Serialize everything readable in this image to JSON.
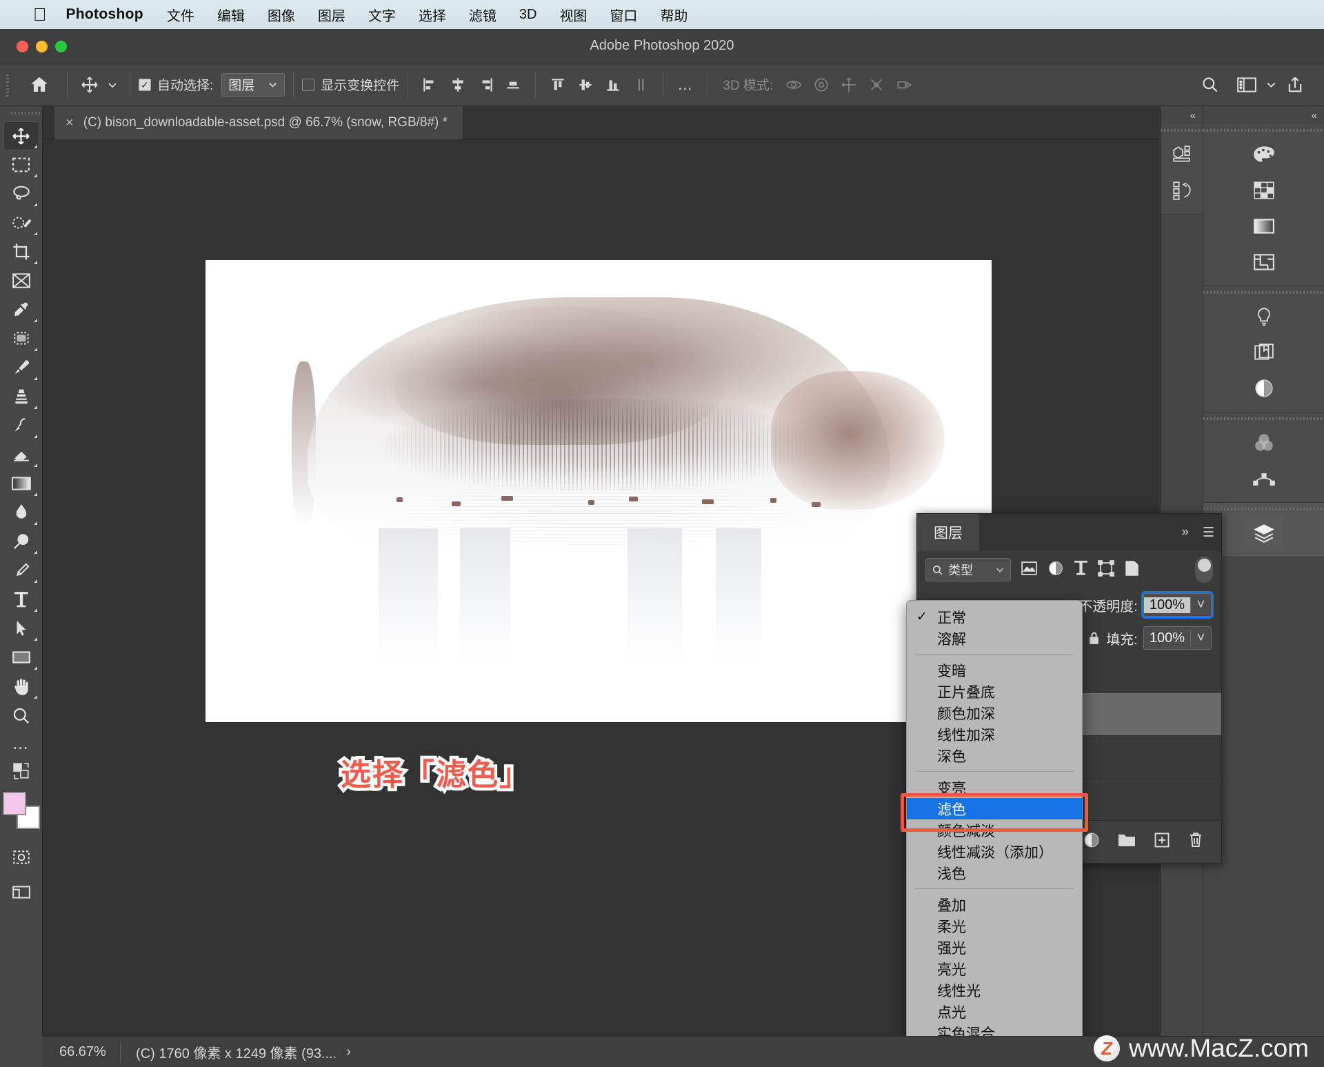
{
  "macmenu": {
    "apple_icon": "apple-logo-icon",
    "app_name": "Photoshop",
    "items": [
      "文件",
      "编辑",
      "图像",
      "图层",
      "文字",
      "选择",
      "滤镜",
      "3D",
      "视图",
      "窗口",
      "帮助"
    ]
  },
  "window": {
    "title": "Adobe Photoshop 2020"
  },
  "options_bar": {
    "home_icon": "home-icon",
    "move_tool_icon": "move-tool-icon",
    "auto_select_label": "自动选择:",
    "auto_select_checked": true,
    "auto_select_value": "图层",
    "show_transform_label": "显示变换控件",
    "show_transform_checked": false,
    "align_icons": [
      "align-left-icon",
      "align-center-horizontal-icon",
      "align-right-icon",
      "align-bottom-icon",
      "align-top-icon",
      "distribute-vertical-icon",
      "align-middle-icon",
      "distribute-horizontal-icon"
    ],
    "more_icon": "more-options-icon",
    "mode_3d_label": "3D 模式:",
    "mode_3d_icons": [
      "orbit-3d-icon",
      "roll-3d-icon",
      "pan-3d-icon",
      "slide-3d-icon",
      "scale-3d-icon"
    ],
    "search_icon": "search-icon",
    "workspace_icon": "workspace-layout-icon",
    "workspace_chevron": "chevron-down-icon",
    "share_icon": "share-upload-icon"
  },
  "toolbar": {
    "tools": [
      {
        "name": "move-tool",
        "icon": "move-icon",
        "selected": true
      },
      {
        "name": "marquee-tool",
        "icon": "rectangular-marquee-icon",
        "selected": false
      },
      {
        "name": "lasso-tool",
        "icon": "lasso-icon",
        "selected": false
      },
      {
        "name": "quick-selection-tool",
        "icon": "quick-selection-icon",
        "selected": false
      },
      {
        "name": "crop-tool",
        "icon": "crop-icon",
        "selected": false
      },
      {
        "name": "frame-tool",
        "icon": "frame-icon",
        "selected": false
      },
      {
        "name": "eyedropper-tool",
        "icon": "eyedropper-icon",
        "selected": false
      },
      {
        "name": "healing-brush-tool",
        "icon": "spot-healing-icon",
        "selected": false
      },
      {
        "name": "brush-tool",
        "icon": "brush-icon",
        "selected": false
      },
      {
        "name": "clone-stamp-tool",
        "icon": "clone-stamp-icon",
        "selected": false
      },
      {
        "name": "history-brush-tool",
        "icon": "history-brush-icon",
        "selected": false
      },
      {
        "name": "eraser-tool",
        "icon": "eraser-icon",
        "selected": false
      },
      {
        "name": "gradient-tool",
        "icon": "gradient-icon",
        "selected": false
      },
      {
        "name": "blur-tool",
        "icon": "blur-drop-icon",
        "selected": false
      },
      {
        "name": "dodge-tool",
        "icon": "dodge-icon",
        "selected": false
      },
      {
        "name": "pen-tool",
        "icon": "pen-icon",
        "selected": false
      },
      {
        "name": "type-tool",
        "icon": "type-t-icon",
        "selected": false
      },
      {
        "name": "path-selection-tool",
        "icon": "path-selection-arrow-icon",
        "selected": false
      },
      {
        "name": "shape-tool",
        "icon": "rectangle-shape-icon",
        "selected": false
      },
      {
        "name": "hand-tool",
        "icon": "hand-icon",
        "selected": false
      },
      {
        "name": "zoom-tool",
        "icon": "zoom-magnifier-icon",
        "selected": false
      },
      {
        "name": "edit-toolbar",
        "icon": "ellipsis-icon",
        "selected": false
      }
    ],
    "foreground_color": "#f2c6e6",
    "background_color": "#ffffff",
    "quickmask_icon": "quick-mask-icon",
    "screenmode_icon": "screen-mode-icon"
  },
  "document": {
    "tab_title": "(C) bison_downloadable-asset.psd @ 66.7% (snow, RGB/8#) *",
    "close_icon": "close-icon"
  },
  "annotation": {
    "text": "选择「滤色」",
    "color": "#ef5b4c"
  },
  "layers_panel": {
    "tab_label": "图层",
    "collapse_icon": "chevron-double-right-icon",
    "menu_icon": "panel-menu-icon",
    "filter": {
      "search_icon": "search-icon",
      "type_label": "类型",
      "chevron_icon": "chevron-down-icon",
      "filter_icons": [
        "image-filter-icon",
        "adjustment-filter-icon",
        "type-filter-icon",
        "shape-filter-icon",
        "smartobject-filter-icon"
      ],
      "toggle_icon": "filter-toggle-icon"
    },
    "opacity_label": "不透明度:",
    "opacity_value": "100%",
    "fill_label": "填充:",
    "fill_value": "100%",
    "lock_icon": "lock-icon",
    "footer_icons": [
      "link-layers-icon",
      "layer-style-icon",
      "layer-mask-icon",
      "adjustment-layer-icon",
      "new-group-icon",
      "new-layer-icon",
      "delete-layer-icon"
    ]
  },
  "blend_menu": {
    "groups": [
      [
        {
          "label": "正常",
          "checked": true,
          "selected": false
        },
        {
          "label": "溶解",
          "checked": false,
          "selected": false
        }
      ],
      [
        {
          "label": "变暗",
          "checked": false,
          "selected": false
        },
        {
          "label": "正片叠底",
          "checked": false,
          "selected": false
        },
        {
          "label": "颜色加深",
          "checked": false,
          "selected": false
        },
        {
          "label": "线性加深",
          "checked": false,
          "selected": false
        },
        {
          "label": "深色",
          "checked": false,
          "selected": false
        }
      ],
      [
        {
          "label": "变亮",
          "checked": false,
          "selected": false
        },
        {
          "label": "滤色",
          "checked": false,
          "selected": true
        },
        {
          "label": "颜色减淡",
          "checked": false,
          "selected": false
        },
        {
          "label": "线性减淡（添加）",
          "checked": false,
          "selected": false
        },
        {
          "label": "浅色",
          "checked": false,
          "selected": false
        }
      ],
      [
        {
          "label": "叠加",
          "checked": false,
          "selected": false
        },
        {
          "label": "柔光",
          "checked": false,
          "selected": false
        },
        {
          "label": "强光",
          "checked": false,
          "selected": false
        },
        {
          "label": "亮光",
          "checked": false,
          "selected": false
        },
        {
          "label": "线性光",
          "checked": false,
          "selected": false
        },
        {
          "label": "点光",
          "checked": false,
          "selected": false
        },
        {
          "label": "实色混合",
          "checked": false,
          "selected": false
        }
      ]
    ],
    "highlight_color": "#1473e6",
    "callout_color": "#f4573f"
  },
  "right_rails": {
    "rail_a": {
      "collapse_icon": "chevron-double-left-icon",
      "icons": [
        "3d-panel-icon",
        "history-panel-icon"
      ]
    },
    "rail_b": {
      "collapse_icon": "chevron-double-left-icon",
      "groups": [
        [
          "color-palette-icon",
          "swatches-grid-icon",
          "gradients-icon",
          "patterns-icon"
        ],
        [
          "learn-bulb-icon",
          "libraries-icon",
          "adjustments-icon"
        ],
        [
          "channels-icon",
          "paths-icon"
        ],
        [
          "layers-icon"
        ]
      ]
    }
  },
  "status_bar": {
    "zoom": "66.67%",
    "doc_info": "(C) 1760 像素 x 1249 像素 (93....",
    "chevron_icon": "chevron-right-icon"
  },
  "watermark": {
    "logo": "macz-logo-icon",
    "text": "www.MacZ.com"
  }
}
